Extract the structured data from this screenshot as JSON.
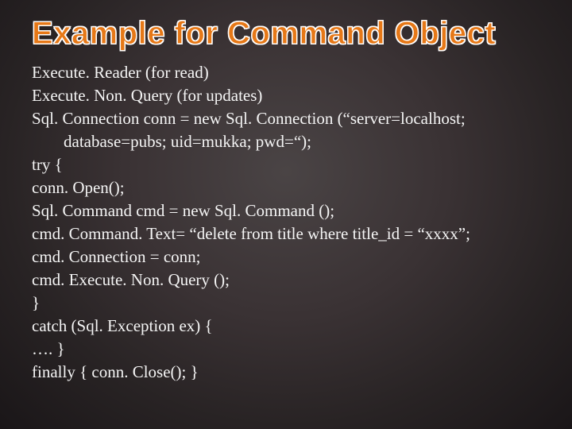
{
  "title": "Example for Command Object",
  "lines": {
    "l0": "Execute. Reader  (for read)",
    "l1": "Execute. Non. Query (for updates)",
    "l2": "Sql. Connection conn = new Sql. Connection (“server=localhost;",
    "l3": "database=pubs; uid=mukka; pwd=“);",
    "l4": "try {",
    "l5": "conn. Open();",
    "l6": "Sql. Command cmd = new Sql. Command ();",
    "l7": "cmd. Command. Text= “delete from title where title_id = “xxxx”;",
    "l8": "cmd. Connection = conn;",
    "l9": "cmd. Execute. Non. Query ();",
    "l10": "}",
    "l11": "catch (Sql. Exception ex) {",
    "l12": "…. }",
    "l13": "finally { conn. Close(); }"
  }
}
